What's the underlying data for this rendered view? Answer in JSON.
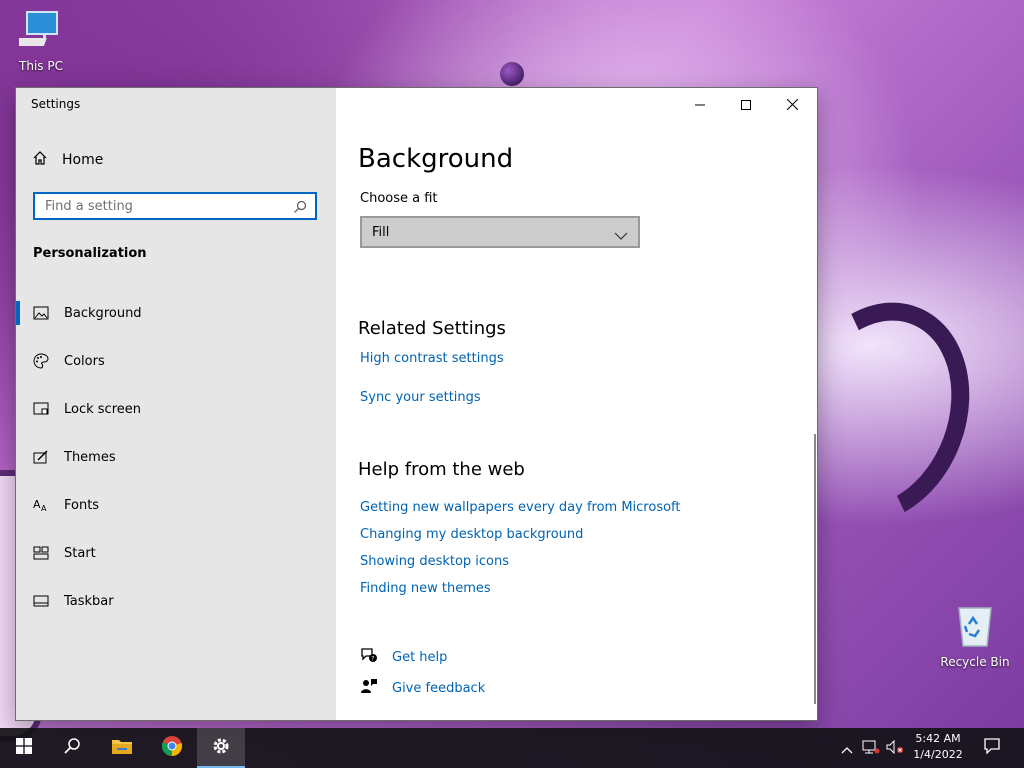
{
  "desktop": {
    "icons": [
      {
        "label": "This PC",
        "icon": "computer-icon"
      },
      {
        "label": "Recycle Bin",
        "icon": "recycle-bin-icon"
      }
    ]
  },
  "window": {
    "title": "Settings",
    "controls": {
      "minimize": "minimize-icon",
      "maximize": "maximize-icon",
      "close": "close-icon"
    }
  },
  "sidebar": {
    "home_label": "Home",
    "search_placeholder": "Find a setting",
    "section_title": "Personalization",
    "items": [
      {
        "label": "Background",
        "icon": "background-icon",
        "active": true
      },
      {
        "label": "Colors",
        "icon": "palette-icon",
        "active": false
      },
      {
        "label": "Lock screen",
        "icon": "lock-screen-icon",
        "active": false
      },
      {
        "label": "Themes",
        "icon": "themes-icon",
        "active": false
      },
      {
        "label": "Fonts",
        "icon": "fonts-icon",
        "active": false
      },
      {
        "label": "Start",
        "icon": "start-icon",
        "active": false
      },
      {
        "label": "Taskbar",
        "icon": "taskbar-icon",
        "active": false
      }
    ]
  },
  "main": {
    "page_title": "Background",
    "fit_label": "Choose a fit",
    "fit_value": "Fill",
    "related_title": "Related Settings",
    "related_links": [
      "High contrast settings",
      "Sync your settings"
    ],
    "help_title": "Help from the web",
    "help_links": [
      "Getting new wallpapers every day from Microsoft",
      "Changing my desktop background",
      "Showing desktop icons",
      "Finding new themes"
    ],
    "get_help": "Get help",
    "give_feedback": "Give feedback"
  },
  "taskbar": {
    "time": "5:42 AM",
    "date": "1/4/2022",
    "pinned": [
      "start-icon",
      "search-icon",
      "file-explorer-icon",
      "chrome-icon",
      "settings-gear-icon"
    ],
    "accent": "#76b9ed"
  }
}
